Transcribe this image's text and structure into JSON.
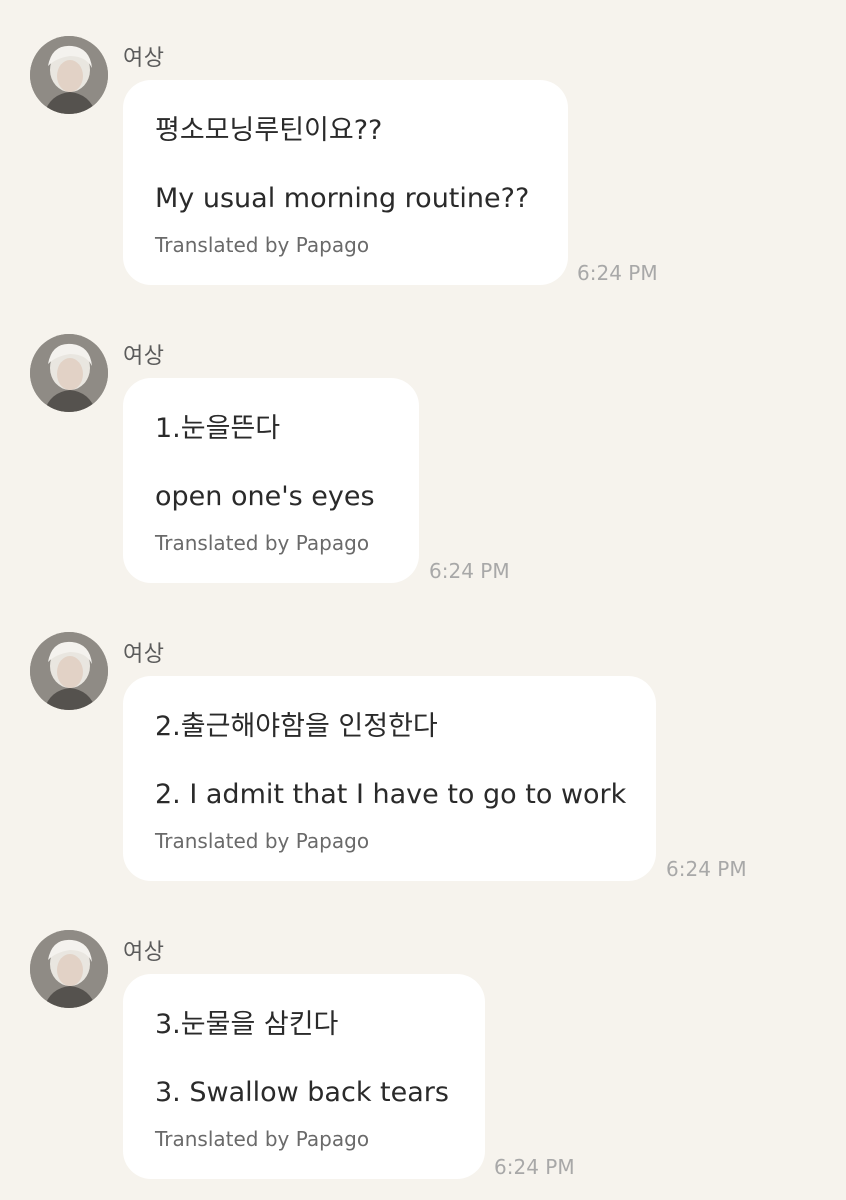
{
  "chat": {
    "messages": [
      {
        "sender": "여상",
        "original": "평소모닝루틴이요??",
        "translation": "My usual morning routine??",
        "translated_by": "Translated by Papago",
        "time": "6:24 PM"
      },
      {
        "sender": "여상",
        "original": "1.눈을뜬다",
        "translation": "open one's eyes",
        "translated_by": "Translated by Papago",
        "time": "6:24 PM"
      },
      {
        "sender": "여상",
        "original": "2.출근해야함을 인정한다",
        "translation": "2. I admit that I have to go to work",
        "translated_by": "Translated by Papago",
        "time": "6:24 PM"
      },
      {
        "sender": "여상",
        "original": "3.눈물을 삼킨다",
        "translation": "3. Swallow back tears",
        "translated_by": "Translated by Papago",
        "time": "6:24 PM"
      }
    ]
  }
}
